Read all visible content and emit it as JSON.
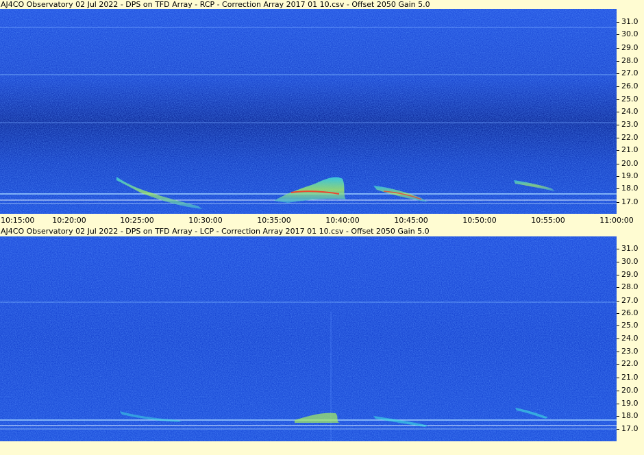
{
  "panels": [
    {
      "title": "AJ4CO Observatory 02  Jul 2022  -  DPS on TFD Array  -  RCP  -  Correction Array 2017 01 10.csv  -  Offset 2050  Gain 5.0",
      "polarization": "RCP"
    },
    {
      "title": "AJ4CO Observatory 02  Jul 2022  -  DPS on TFD Array  -  LCP  -  Correction Array 2017 01 10.csv  -  Offset 2050  Gain 5.0",
      "polarization": "LCP"
    }
  ],
  "frequency_axis": {
    "labels": [
      "31.0",
      "30.0",
      "29.0",
      "28.0",
      "27.0",
      "26.0",
      "25.0",
      "24.0",
      "23.0",
      "22.0",
      "21.0",
      "20.0",
      "19.0",
      "18.0",
      "17.0"
    ]
  },
  "time_axis": {
    "labels": [
      "10:15:00",
      "10:20:00",
      "10:25:00",
      "10:30:00",
      "10:35:00",
      "10:40:00",
      "10:45:00",
      "10:50:00",
      "10:55:00",
      "11:00:00"
    ]
  },
  "colors": {
    "background": "#fffcd2",
    "spectrogram_base": "#1a49d6",
    "spectrogram_dark": "#0a2a9a",
    "burst_cyan": "#3fe0e0",
    "burst_green": "#9cf060",
    "burst_red": "#ff3020"
  }
}
